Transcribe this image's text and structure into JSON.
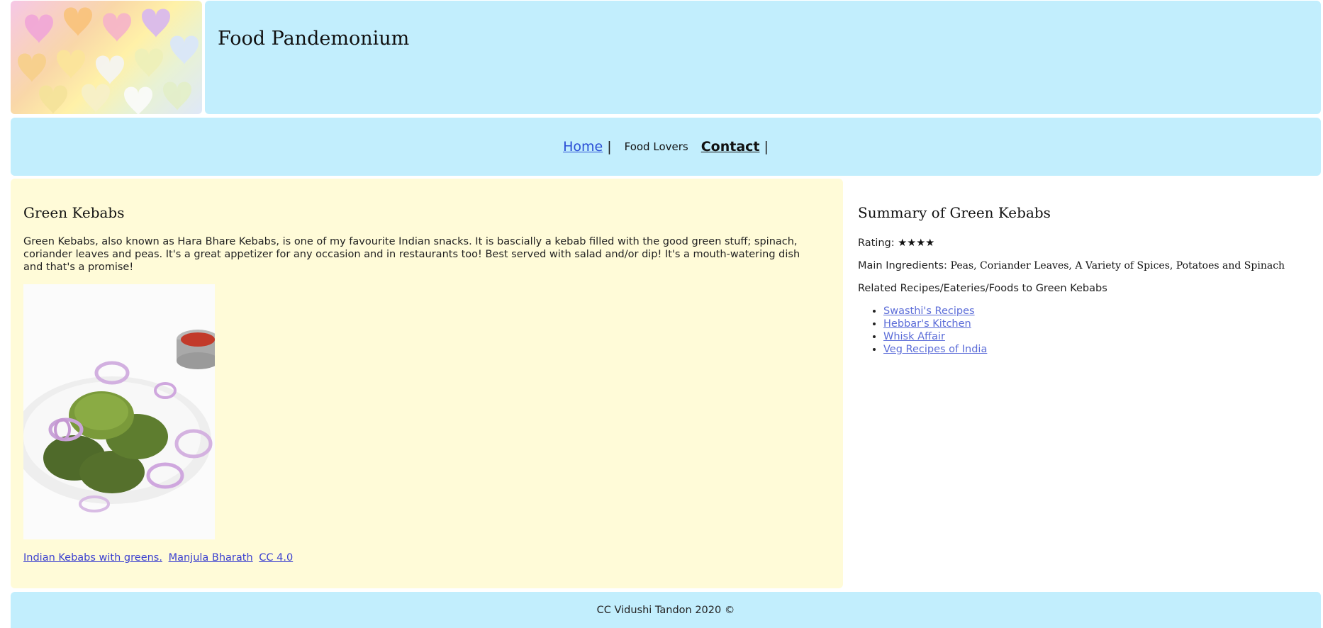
{
  "header": {
    "site_title": "Food Pandemonium"
  },
  "nav": {
    "home_label": "Home",
    "separator": "|",
    "food_lovers_label": "Food Lovers",
    "contact_label": "Contact"
  },
  "article": {
    "heading": "Green Kebabs",
    "intro": "Green Kebabs, also known as Hara Bhare Kebabs, is one of my favourite Indian snacks. It is bascially a kebab filled with the good green stuff; spinach, coriander leaves and peas. It's a great appetizer for any occasion and in restaurants too! Best served with salad and/or dip! It's a mouth-watering dish and that's a promise!",
    "credits": {
      "image_title": "Indian Kebabs with greens.",
      "author": "Manjula Bharath",
      "license": "CC 4.0"
    }
  },
  "summary": {
    "heading": "Summary of Green Kebabs",
    "rating_label": "Rating:",
    "rating_stars": "★★★★",
    "ingredients_label": "Main Ingredients:",
    "ingredients_value": "Peas, Coriander Leaves, A Variety of Spices, Potatoes and Spinach",
    "related_label": "Related Recipes/Eateries/Foods to Green Kebabs",
    "related_links": [
      "Swasthi's Recipes",
      "Hebbar's Kitchen",
      "Whisk Affair",
      "Veg Recipes of India"
    ]
  },
  "footer": {
    "text": "CC Vidushi Tandon 2020 ©"
  }
}
